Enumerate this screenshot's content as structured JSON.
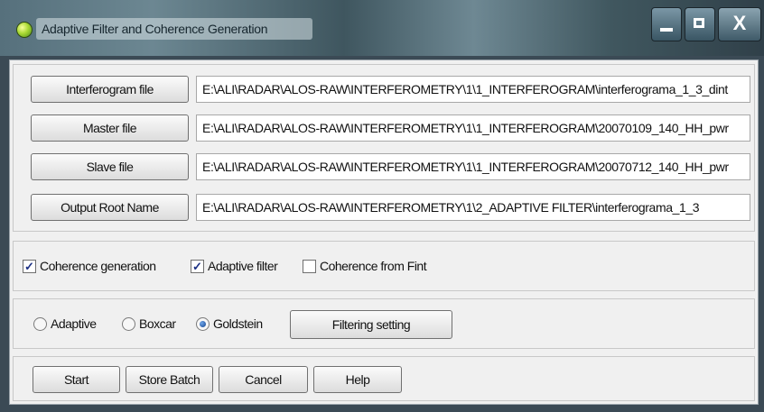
{
  "window": {
    "title": "Adaptive Filter and Coherence Generation",
    "controls": {
      "close_label": "X"
    }
  },
  "files": {
    "interferogram": {
      "button": "Interferogram file",
      "value": "E:\\ALI\\RADAR\\ALOS-RAW\\INTERFEROMETRY\\1\\1_INTERFEROGRAM\\interferograma_1_3_dint"
    },
    "master": {
      "button": "Master file",
      "value": "E:\\ALI\\RADAR\\ALOS-RAW\\INTERFEROMETRY\\1\\1_INTERFEROGRAM\\20070109_140_HH_pwr"
    },
    "slave": {
      "button": "Slave file",
      "value": "E:\\ALI\\RADAR\\ALOS-RAW\\INTERFEROMETRY\\1\\1_INTERFEROGRAM\\20070712_140_HH_pwr"
    },
    "output": {
      "button": "Output Root Name",
      "value": "E:\\ALI\\RADAR\\ALOS-RAW\\INTERFEROMETRY\\1\\2_ADAPTIVE FILTER\\interferograma_1_3"
    }
  },
  "options": {
    "coherence_generation": {
      "label": "Coherence generation",
      "checked": true
    },
    "adaptive_filter": {
      "label": "Adaptive filter",
      "checked": true
    },
    "coherence_from_fint": {
      "label": "Coherence from Fint",
      "checked": false
    }
  },
  "filter": {
    "adaptive": {
      "label": "Adaptive",
      "selected": false
    },
    "boxcar": {
      "label": "Boxcar",
      "selected": false
    },
    "goldstein": {
      "label": "Goldstein",
      "selected": true
    },
    "setting_button": "Filtering setting"
  },
  "actions": {
    "start": "Start",
    "store_batch": "Store Batch",
    "cancel": "Cancel",
    "help": "Help"
  },
  "colors": {
    "titlebar": "#4f6a75",
    "client_bg": "#f0f0f0",
    "check_mark": "#1b2f84",
    "radio_selected": "#14438f"
  }
}
